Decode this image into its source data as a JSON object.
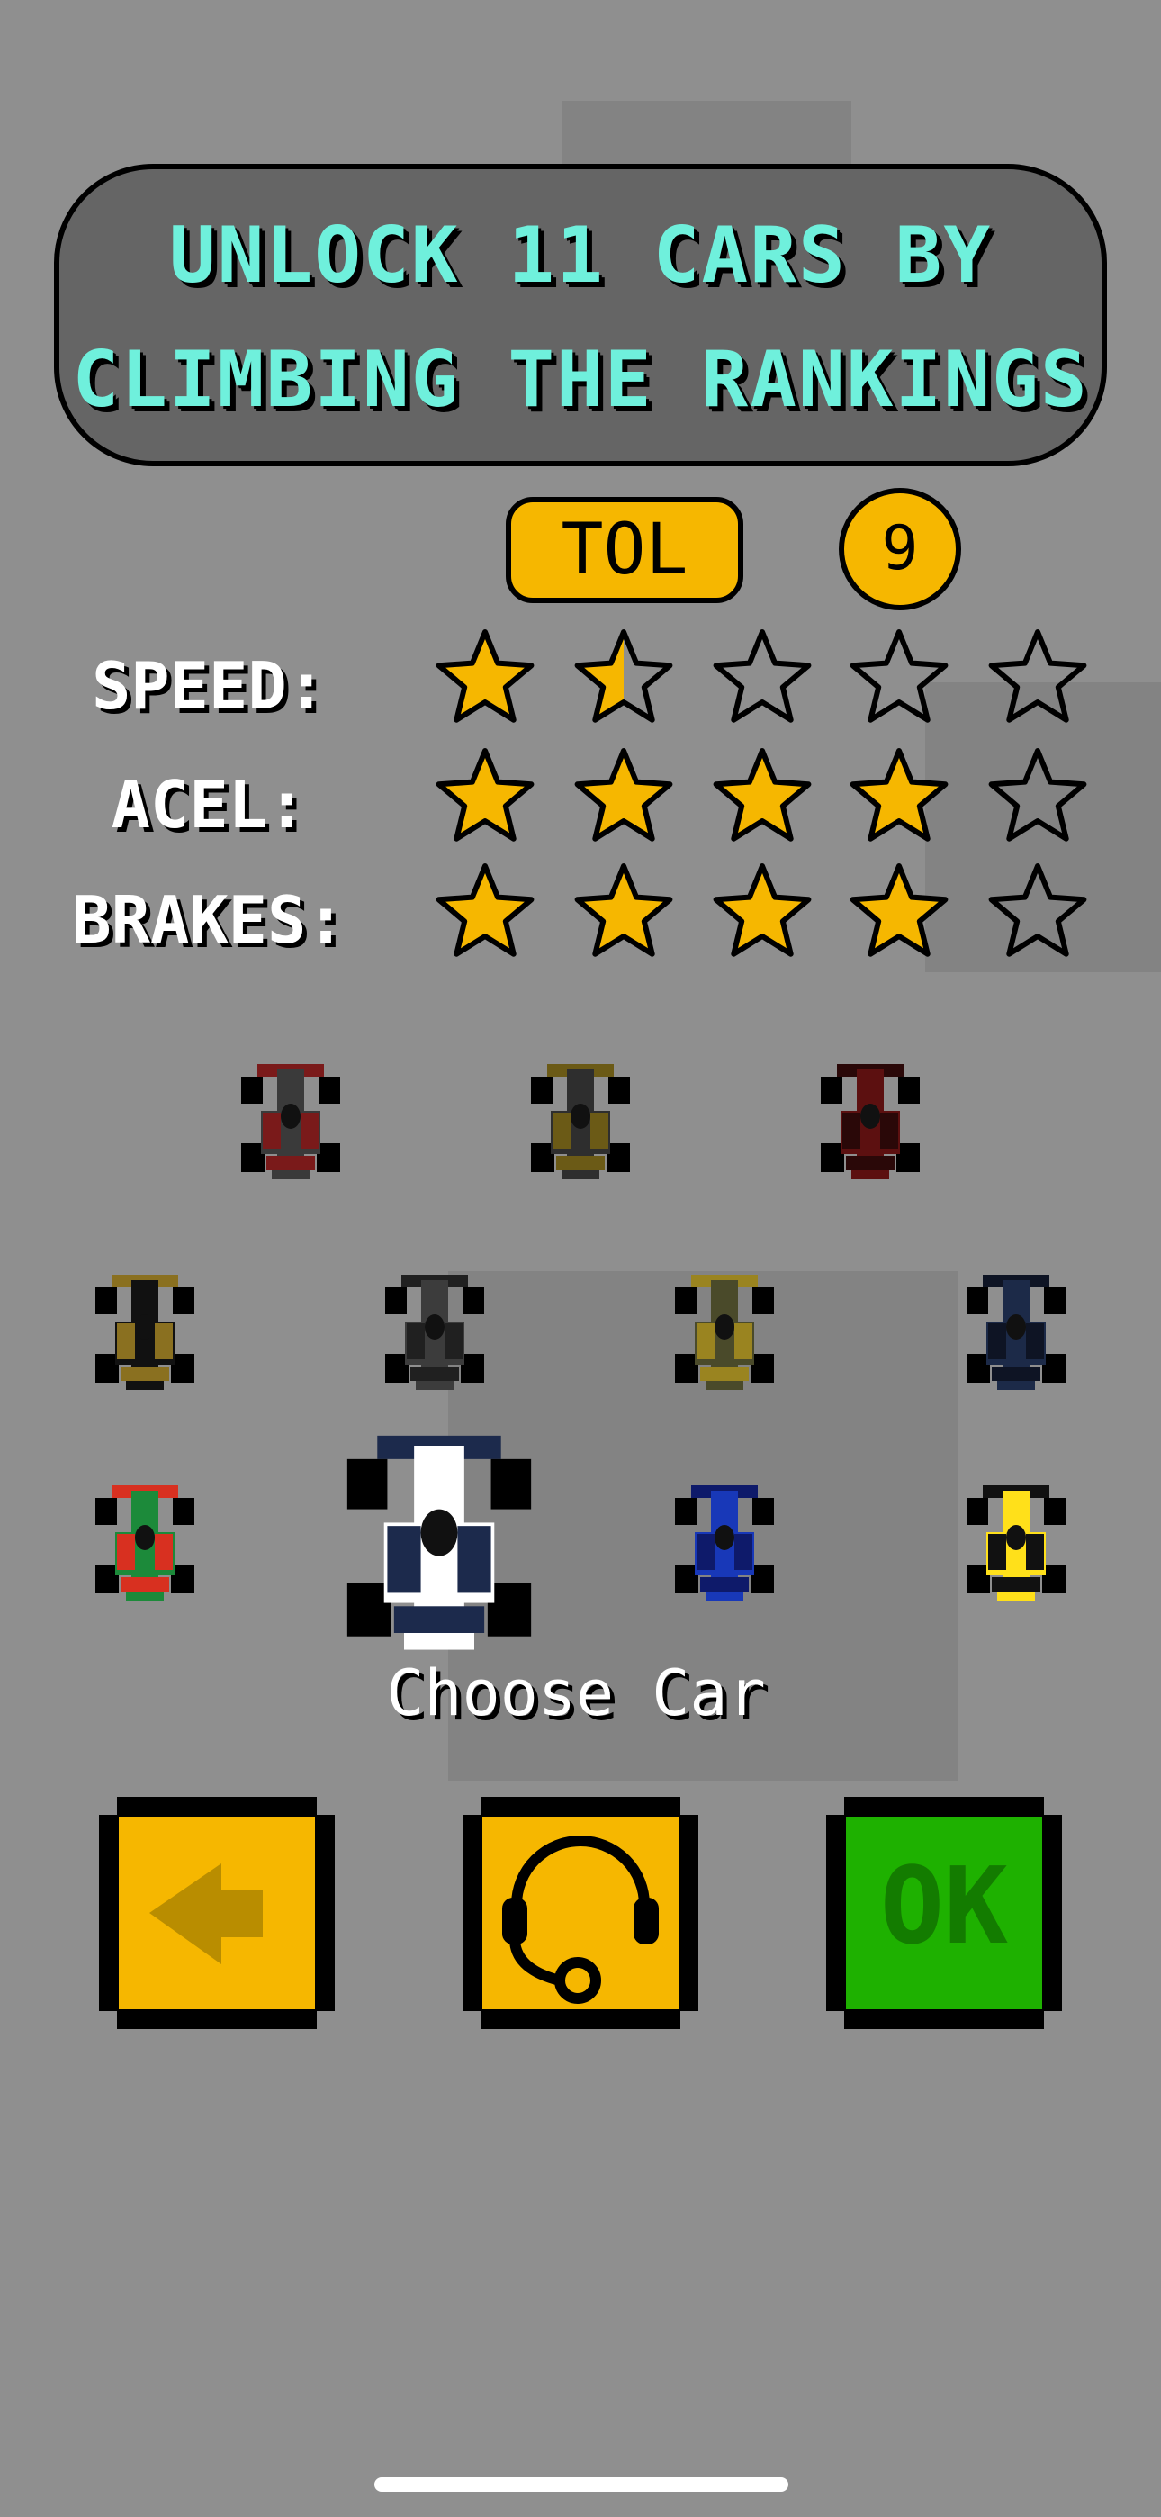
{
  "banner": {
    "line1": "UNLOCK 11 CARS BY",
    "line2": "CLIMBING THE RANKINGS"
  },
  "selected_car": {
    "team": "TOL",
    "level": "9"
  },
  "stats": [
    {
      "label": "SPEED:",
      "rating": 1.5,
      "max": 5
    },
    {
      "label": "ACEL:",
      "rating": 4,
      "max": 5
    },
    {
      "label": "BRAKES:",
      "rating": 4,
      "max": 5
    }
  ],
  "cars": [
    {
      "name": "car-dark-red-black",
      "body": "#3a3a3a",
      "accent": "#7a1a1a"
    },
    {
      "name": "car-black-gold",
      "body": "#2e2e2e",
      "accent": "#6b5a16"
    },
    {
      "name": "car-maroon",
      "body": "#5c1010",
      "accent": "#2a0808"
    },
    {
      "name": "car-black-gold-stripe",
      "body": "#111111",
      "accent": "#8a7020"
    },
    {
      "name": "car-dark-grey",
      "body": "#3c3c3c",
      "accent": "#202020"
    },
    {
      "name": "car-olive-gold",
      "body": "#4a4a2a",
      "accent": "#9a8420"
    },
    {
      "name": "car-navy",
      "body": "#1c2a48",
      "accent": "#0e1424"
    },
    {
      "name": "car-green",
      "body": "#1c8a3a",
      "accent": "#d83020"
    },
    {
      "name": "car-white-navy-selected",
      "body": "#ffffff",
      "accent": "#1c2a4c"
    },
    {
      "name": "car-blue",
      "body": "#1838b8",
      "accent": "#0e1a6a"
    },
    {
      "name": "car-yellow-black",
      "body": "#ffe01a",
      "accent": "#111111"
    }
  ],
  "choose_label": "Choose Car",
  "buttons": {
    "ok_label": "OK"
  },
  "colors": {
    "background": "#8f8f8f",
    "banner_text": "#6ff0dc",
    "yellow": "#f6b700",
    "green": "#1eb100"
  }
}
